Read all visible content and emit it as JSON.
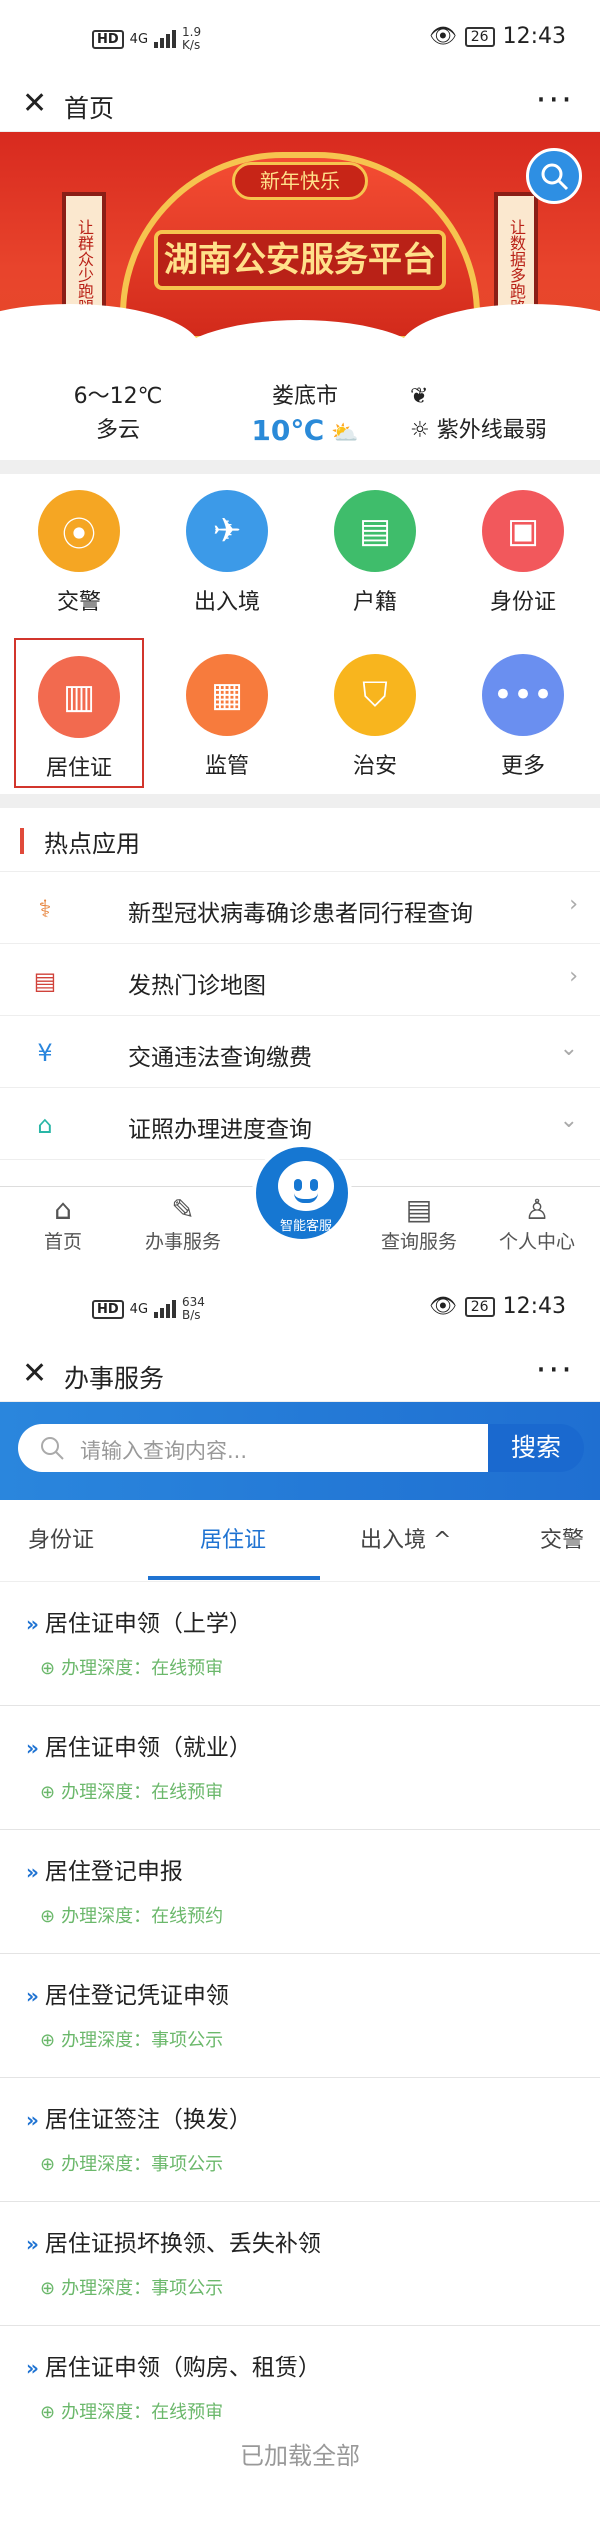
{
  "screen1": {
    "status": {
      "network": "4G",
      "speed": "1.9",
      "speed_unit": "K/s",
      "battery": "26",
      "time": "12:43",
      "hd": "HD"
    },
    "title": "首页",
    "banner": {
      "ribbon": "新年快乐",
      "main_title": "湖南公安服务平台",
      "left_scroll": "让群众少跑腿",
      "right_scroll": "让数据多跑路"
    },
    "weather": {
      "temp_range": "6～12℃",
      "condition": "多云",
      "city": "娄底市",
      "current_temp": "10℃",
      "uv": "紫外线最弱"
    },
    "grid": [
      {
        "label": "交警",
        "color": "#f5a623",
        "icon": "traffic-light-icon"
      },
      {
        "label": "出入境",
        "color": "#3c9ae8",
        "icon": "airplane-icon"
      },
      {
        "label": "户籍",
        "color": "#3fbd6b",
        "icon": "id-card-icon"
      },
      {
        "label": "身份证",
        "color": "#f2585c",
        "icon": "identity-card-icon"
      },
      {
        "label": "居住证",
        "color": "#f26a4f",
        "icon": "residence-card-icon"
      },
      {
        "label": "监管",
        "color": "#f77b3d",
        "icon": "prison-icon"
      },
      {
        "label": "治安",
        "color": "#f8b51e",
        "icon": "shield-icon"
      },
      {
        "label": "更多",
        "color": "#6a8ff0",
        "icon": "more-icon"
      }
    ],
    "hot_title": "热点应用",
    "hot_list": [
      {
        "label": "新型冠状病毒确诊患者同行程查询",
        "icon": "doctor-icon",
        "chev": "›"
      },
      {
        "label": "发热门诊地图",
        "icon": "map-icon",
        "chev": "›"
      },
      {
        "label": "交通违法查询缴费",
        "icon": "yuan-icon",
        "chev": "⌄"
      },
      {
        "label": "证照办理进度查询",
        "icon": "house-icon",
        "chev": "⌄"
      }
    ],
    "tabbar": {
      "home": "首页",
      "service": "办事服务",
      "robot": "智能客服",
      "query": "查询服务",
      "me": "个人中心"
    }
  },
  "screen2": {
    "status": {
      "network": "4G",
      "speed": "634",
      "speed_unit": "B/s",
      "battery": "26",
      "time": "12:43",
      "hd": "HD"
    },
    "title": "办事服务",
    "search": {
      "placeholder": "请输入查询内容...",
      "button": "搜索"
    },
    "tabs": [
      "身份证",
      "居住证",
      "出入境 ^",
      "交警"
    ],
    "items": [
      {
        "name": "居住证申领（上学）",
        "depth": "办理深度：在线预审"
      },
      {
        "name": "居住证申领（就业）",
        "depth": "办理深度：在线预审"
      },
      {
        "name": "居住登记申报",
        "depth": "办理深度：在线预约"
      },
      {
        "name": "居住登记凭证申领",
        "depth": "办理深度：事项公示"
      },
      {
        "name": "居住证签注（换发）",
        "depth": "办理深度：事项公示"
      },
      {
        "name": "居住证损坏换领、丢失补领",
        "depth": "办理深度：事项公示"
      },
      {
        "name": "居住证申领（购房、租赁）",
        "depth": "办理深度：在线预审"
      }
    ],
    "footer": "已加载全部"
  }
}
